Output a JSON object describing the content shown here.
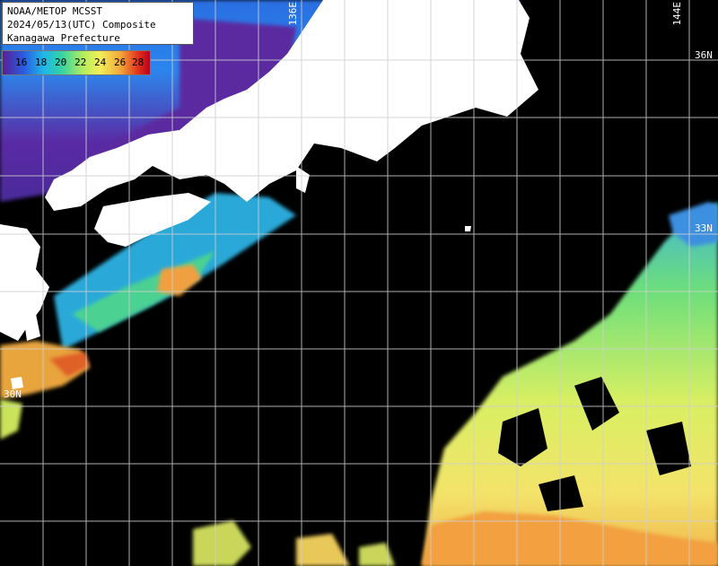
{
  "title": {
    "line1": "NOAA/METOP MCSST",
    "line2": "2024/05/13(UTC) Composite",
    "line3": "Kanagawa Prefecture"
  },
  "legend": {
    "ticks": [
      "16",
      "18",
      "20",
      "22",
      "24",
      "26",
      "28"
    ]
  },
  "grid_labels": {
    "lon_136": "136E",
    "lon_144": "144E",
    "lat_36": "36N",
    "lat_33": "33N",
    "lat_30": "30N"
  },
  "colors": {
    "ocean_missing": "#000000",
    "land": "#ffffff",
    "gridline": "#ffffff"
  }
}
